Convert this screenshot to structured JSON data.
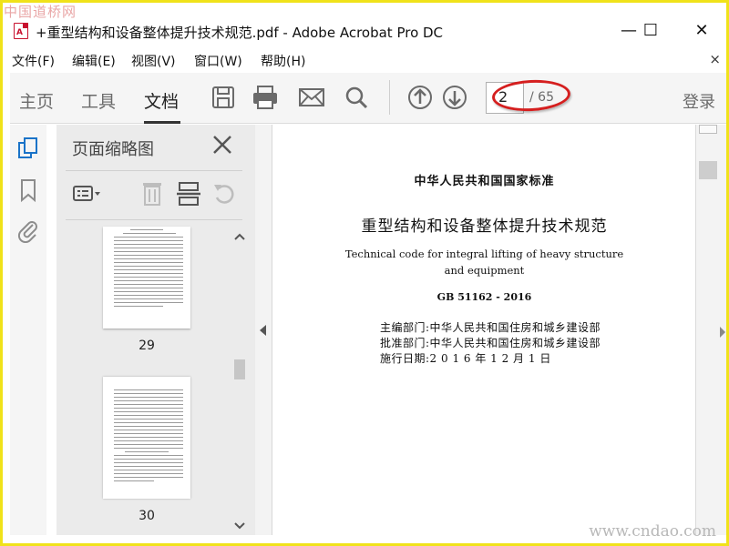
{
  "watermark": {
    "top_left": "中国道桥网",
    "bottom_right": "www.cndao.com"
  },
  "window": {
    "title": "+重型结构和设备整体提升技术规范.pdf - Adobe Acrobat Pro DC",
    "minimize": "—",
    "maximize": "☐",
    "close": "✕",
    "icon": "pdf-file-icon"
  },
  "menu": {
    "items": [
      "文件(F)",
      "编辑(E)",
      "视图(V)",
      "窗口(W)",
      "帮助(H)"
    ],
    "close": "×"
  },
  "toolbar": {
    "tabs": [
      "主页",
      "工具",
      "文档"
    ],
    "active_tab": "文档",
    "icons": [
      "save-icon",
      "print-icon",
      "email-icon",
      "search-icon",
      "page-up-icon",
      "page-down-icon"
    ],
    "page_current": "2",
    "page_total": "/ 65",
    "login": "登录",
    "highlight_color": "#d51f1f"
  },
  "left_rail": {
    "icons": [
      "page-thumbnails-icon",
      "bookmark-icon",
      "attachment-icon"
    ]
  },
  "thumbnail_panel": {
    "title": "页面缩略图",
    "tools": [
      "thumbnail-options-icon",
      "delete-page-icon",
      "extract-page-icon",
      "rotate-page-icon"
    ],
    "thumbnails": [
      {
        "label": "29"
      },
      {
        "label": "30"
      }
    ]
  },
  "document": {
    "header": "中华人民共和国国家标准",
    "title_cn": "重型结构和设备整体提升技术规范",
    "title_en_line1": "Technical code for integral lifting of heavy structure",
    "title_en_line2": "and equipment",
    "code": "GB 51162 - 2016",
    "editor": "主编部门:中华人民共和国住房和城乡建设部",
    "approver": "批准部门:中华人民共和国住房和城乡建设部",
    "effective": "施行日期:2 0 1 6 年 1 2 月 1 日"
  },
  "colors": {
    "accent": "#1a73c8",
    "toolbar_bg": "#f5f5f5",
    "panel_bg": "#ebebeb"
  }
}
